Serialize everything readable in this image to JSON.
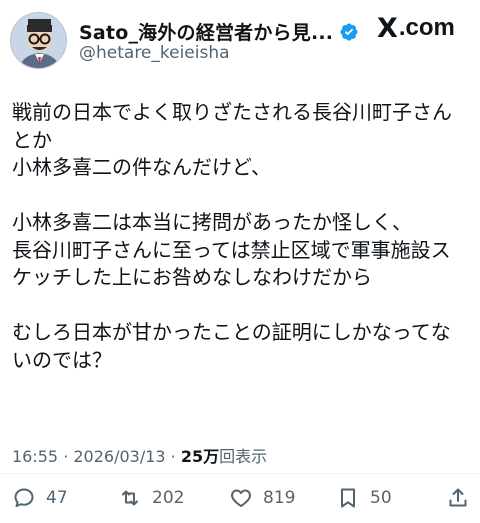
{
  "author": {
    "display_name": "Sato_海外の経営者から見...",
    "handle": "@hetare_keieisha",
    "verified_icon": "verified-badge-icon"
  },
  "brand": {
    "mark": "X",
    "text": ".com"
  },
  "post": {
    "lines_1": [
      "戦前の日本でよく取りざたされる長谷川町子さん",
      "とか",
      "小林多喜二の件なんだけど、"
    ],
    "lines_2": [
      "小林多喜二は本当に拷問があったか怪しく、",
      "長谷川町子さんに至っては禁止区域で軍事施設ス",
      "ケッチした上にお咎めなしなわけだから"
    ],
    "lines_3": [
      "むしろ日本が甘かったことの証明にしかなってな",
      "いのでは？"
    ]
  },
  "meta": {
    "time_date": "16:55 · 2026/03/13 · ",
    "views_count": "25万",
    "views_label": "回表示"
  },
  "actions": {
    "reply_count": "47",
    "repost_count": "202",
    "like_count": "819",
    "bookmark_count": "50"
  },
  "colors": {
    "text": "#0f1419",
    "secondary": "#536471",
    "verified": "#1d9bf0"
  }
}
